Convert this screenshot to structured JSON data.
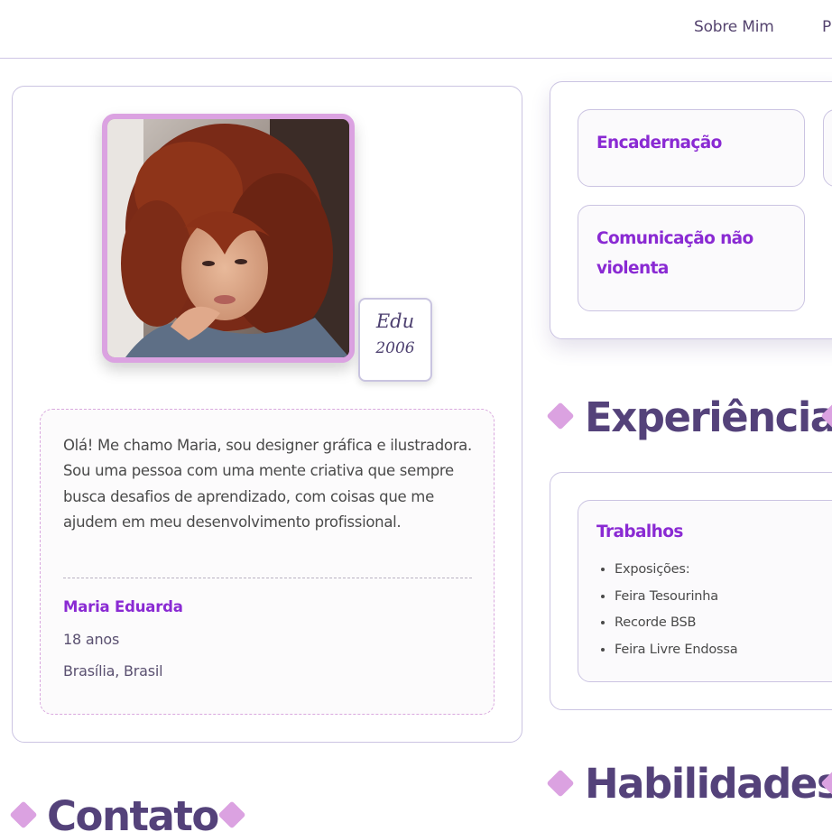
{
  "nav": {
    "links": [
      "Sobre Mim",
      "P"
    ]
  },
  "profile": {
    "photo_alt": "Retrato de Maria Eduarda",
    "badge": {
      "name": "Edu",
      "year": "2006"
    },
    "bio": "Olá! Me chamo Maria, sou designer gráfica e ilustradora. Sou uma pessoa com uma mente criativa que sempre busca desafios de aprendizado, com coisas que me ajudem em meu desenvolvimento profissional.",
    "name": "Maria Eduarda",
    "age": "18 anos",
    "location": "Brasília, Brasil"
  },
  "courses": {
    "items": [
      "Encadernação",
      "Comunicação não violenta"
    ]
  },
  "sections": {
    "experience": "Experiência",
    "skills": "Habilidades",
    "contact": "Contato"
  },
  "experience": {
    "title": "Trabalhos",
    "items": [
      "Exposições:",
      "Feira Tesourinha",
      "Recorde BSB",
      "Feira Livre Endossa"
    ]
  },
  "colors": {
    "accent_purple": "#8a2ad3",
    "heading_purple": "#54427a",
    "diamond_pink": "#dba2e1",
    "border_lavender": "#cbc4e2"
  }
}
